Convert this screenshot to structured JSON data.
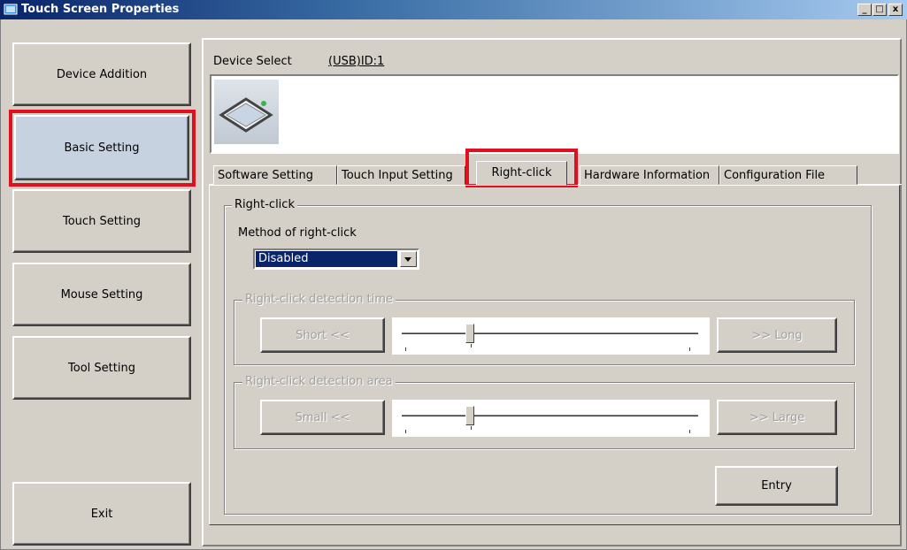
{
  "window": {
    "title": "Touch Screen Properties",
    "minimize": "_",
    "maximize": "□",
    "close": "x"
  },
  "sidebar": {
    "items": [
      {
        "label": "Device Addition"
      },
      {
        "label": "Basic Setting"
      },
      {
        "label": "Touch Setting"
      },
      {
        "label": "Mouse Setting"
      },
      {
        "label": "Tool Setting"
      }
    ],
    "exit_label": "Exit"
  },
  "device": {
    "select_label": "Device Select",
    "select_value": "(USB)ID:1"
  },
  "tabs": [
    {
      "label": "Software Setting"
    },
    {
      "label": "Touch Input Setting"
    },
    {
      "label": "Right-click"
    },
    {
      "label": "Hardware Information"
    },
    {
      "label": "Configuration File"
    }
  ],
  "rightclick": {
    "group_label": "Right-click",
    "method_label": "Method of right-click",
    "method_value": "Disabled",
    "time_group_label": "Right-click detection time",
    "time_short_label": "Short <<",
    "time_long_label": ">> Long",
    "area_group_label": "Right-click detection area",
    "area_small_label": "Small <<",
    "area_large_label": ">> Large",
    "entry_label": "Entry"
  },
  "sliders": {
    "time_level": 0.23,
    "area_level": 0.23
  },
  "colors": {
    "highlight": "#e0101e",
    "selection": "#0a246a"
  }
}
